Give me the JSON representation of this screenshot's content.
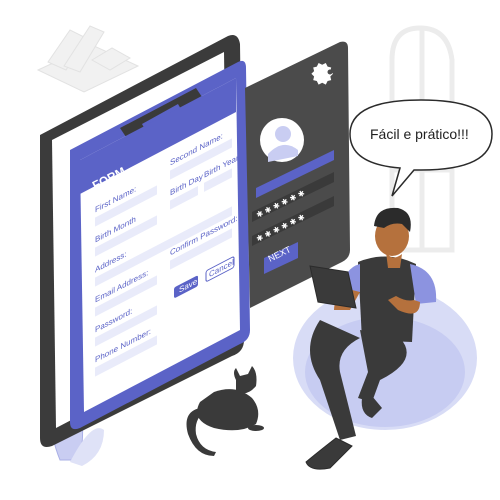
{
  "speech_bubble": {
    "text": "Fácil e prático!!!"
  },
  "form": {
    "title": "FORM",
    "fields": {
      "first_name": "First Name:",
      "second_name": "Second Name:",
      "birth_month": "Birth Month",
      "birth_day": "Birth Day",
      "birth_year": "Birth Year",
      "address": "Address:",
      "email": "Email Address:",
      "password": "Password:",
      "confirm_password": "Confirm Password:",
      "phone": "Phone Number:"
    },
    "save_label": "Save",
    "cancel_label": "Cancel"
  },
  "login_panel": {
    "password_mask_1": "✱ ✱ ✱ ✱ ✱ ✱",
    "password_mask_2": "✱ ✱ ✱ ✱ ✱ ✱",
    "next_label": "NEXT"
  },
  "icons": {
    "settings": "gear-icon",
    "avatar": "user-avatar-icon"
  },
  "colors": {
    "accent": "#5b63c7",
    "accent_light": "#c9cdf2",
    "dark": "#3a3a3a",
    "panel": "#4b4b4b"
  }
}
